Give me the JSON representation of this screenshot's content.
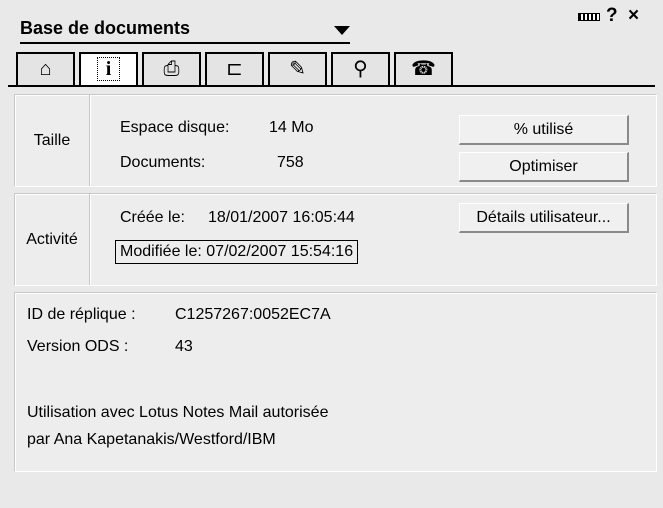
{
  "header": {
    "title": "Base de documents",
    "help_label": "?",
    "close_label": "×"
  },
  "tabs": [
    {
      "icon": "book-icon",
      "glyph": "⌂",
      "active": false
    },
    {
      "icon": "info-icon",
      "glyph": "i",
      "active": true
    },
    {
      "icon": "printer-icon",
      "glyph": "⎙",
      "active": false
    },
    {
      "icon": "design-icon",
      "glyph": "⊏",
      "active": false
    },
    {
      "icon": "pen-icon",
      "glyph": "✎",
      "active": false
    },
    {
      "icon": "search-icon",
      "glyph": "⚲",
      "active": false
    },
    {
      "icon": "index-icon",
      "glyph": "☎",
      "active": false
    }
  ],
  "taille": {
    "label": "Taille",
    "disk_label": "Espace disque:",
    "disk_value": "14 Mo",
    "docs_label": "Documents:",
    "docs_value": "758",
    "used_button": "% utilisé",
    "optimize_button": "Optimiser"
  },
  "activite": {
    "label": "Activité",
    "created_label": "Créée le:",
    "created_value": "18/01/2007 16:05:44",
    "modified_label": "Modifiée le:",
    "modified_value": "07/02/2007 15:54:16",
    "details_button": "Détails utilisateur..."
  },
  "info": {
    "replica_label": "ID de réplique :",
    "replica_value": "C1257267:0052EC7A",
    "ods_label": "Version ODS :",
    "ods_value": "43",
    "mail_line1": "Utilisation avec Lotus Notes Mail autorisée",
    "mail_line2": "par Ana Kapetanakis/Westford/IBM"
  }
}
